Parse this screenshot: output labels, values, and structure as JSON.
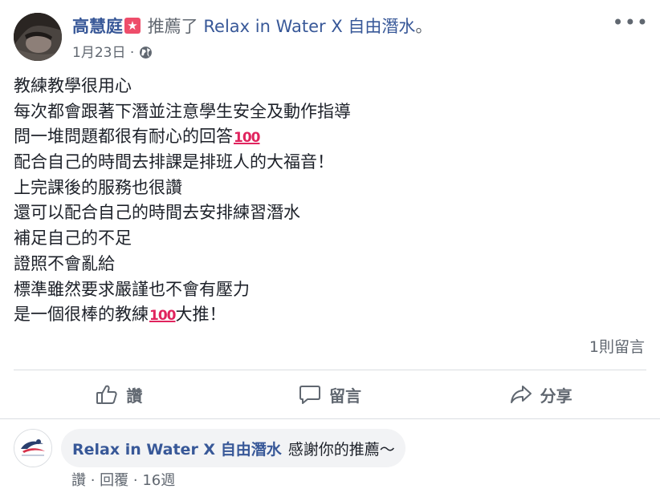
{
  "post": {
    "author": "高慧庭",
    "badge_icon": "star-badge",
    "verb": "推薦了",
    "page": "Relax in Water X 自由潛水",
    "period": "。",
    "date": "1月23日",
    "separator": "·",
    "privacy_icon": "globe-icon",
    "more": "•••",
    "lines": [
      {
        "text": "教練教學很用心",
        "emoji": ""
      },
      {
        "text": "每次都會跟著下潛並注意學生安全及動作指導",
        "emoji": ""
      },
      {
        "text": "問一堆問題都很有耐心的回答",
        "emoji": "100"
      },
      {
        "text": "配合自己的時間去排課是排班人的大福音！",
        "emoji": ""
      },
      {
        "text": "上完課後的服務也很讚",
        "emoji": ""
      },
      {
        "text": "還可以配合自己的時間去安排練習潛水",
        "emoji": ""
      },
      {
        "text": "補足自己的不足",
        "emoji": ""
      },
      {
        "text": "證照不會亂給",
        "emoji": ""
      },
      {
        "text": "標準雖然要求嚴謹也不會有壓力",
        "emoji": ""
      },
      {
        "text": "是一個很棒的教練",
        "emoji": "100",
        "after": "大推！"
      }
    ],
    "comment_count": "1則留言"
  },
  "actions": {
    "like": "讚",
    "comment": "留言",
    "share": "分享"
  },
  "comment": {
    "name": "Relax in Water X 自由潛水",
    "text": "感謝你的推薦～",
    "like": "讚",
    "dot": " · ",
    "reply": "回覆",
    "time": "16週"
  }
}
